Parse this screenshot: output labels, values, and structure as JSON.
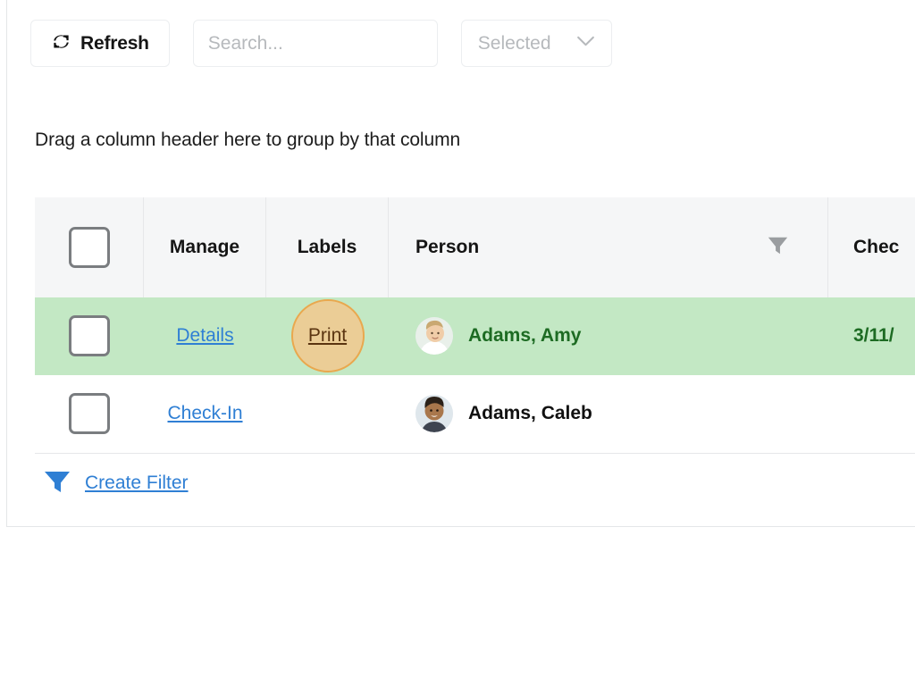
{
  "toolbar": {
    "refresh_label": "Refresh",
    "refresh_icon": "refresh-icon",
    "search_placeholder": "Search...",
    "search_value": "",
    "selected_label": "Selected",
    "selected_chevron_icon": "chevron-down-icon"
  },
  "group_panel": {
    "hint": "Drag a column header here to group by that column"
  },
  "grid": {
    "columns": [
      {
        "key": "select",
        "label": "",
        "has_header_checkbox": true
      },
      {
        "key": "manage",
        "label": "Manage"
      },
      {
        "key": "labels",
        "label": "Labels"
      },
      {
        "key": "person",
        "label": "Person",
        "filter_icon": "filter-icon"
      },
      {
        "key": "checkin",
        "label": "Chec"
      }
    ],
    "rows": [
      {
        "selected": false,
        "highlighted": true,
        "manage": "Details",
        "labels": "Print",
        "labels_active": true,
        "person": "Adams, Amy",
        "avatar": "avatar-amy",
        "checkin": "3/11/"
      },
      {
        "selected": false,
        "highlighted": false,
        "manage": "Check-In",
        "labels": "",
        "labels_active": false,
        "person": "Adams, Caleb",
        "avatar": "avatar-caleb",
        "checkin": ""
      }
    ],
    "footer": {
      "create_filter_label": "Create Filter",
      "create_filter_icon": "filter-icon"
    }
  },
  "colors": {
    "row_highlight": "#c3e8c4",
    "link": "#2f7fd4",
    "green_text": "#1d6b23",
    "click_halo": "#ebcd96",
    "click_halo_border": "#e9a84e"
  }
}
